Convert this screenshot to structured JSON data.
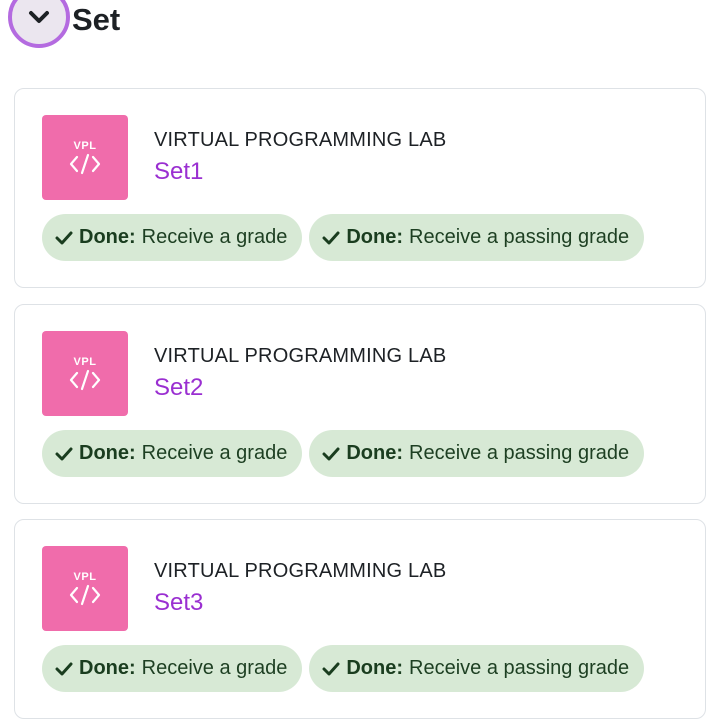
{
  "section": {
    "title": "Set",
    "toggle_icon": "chevron-down-icon"
  },
  "colors": {
    "accent_purple": "#9a2fd1",
    "icon_pink": "#f06cab",
    "badge_green": "#d7e9d5",
    "focus_ring": "#b46be0"
  },
  "activities": [
    {
      "icon": "vpl-code-icon",
      "icon_label": "VPL",
      "type": "VIRTUAL PROGRAMMING LAB",
      "name": "Set1",
      "completion": [
        {
          "status": "Done:",
          "condition": "Receive a grade"
        },
        {
          "status": "Done:",
          "condition": "Receive a passing grade"
        }
      ]
    },
    {
      "icon": "vpl-code-icon",
      "icon_label": "VPL",
      "type": "VIRTUAL PROGRAMMING LAB",
      "name": "Set2",
      "completion": [
        {
          "status": "Done:",
          "condition": "Receive a grade"
        },
        {
          "status": "Done:",
          "condition": "Receive a passing grade"
        }
      ]
    },
    {
      "icon": "vpl-code-icon",
      "icon_label": "VPL",
      "type": "VIRTUAL PROGRAMMING LAB",
      "name": "Set3",
      "completion": [
        {
          "status": "Done:",
          "condition": "Receive a grade"
        },
        {
          "status": "Done:",
          "condition": "Receive a passing grade"
        }
      ]
    }
  ]
}
